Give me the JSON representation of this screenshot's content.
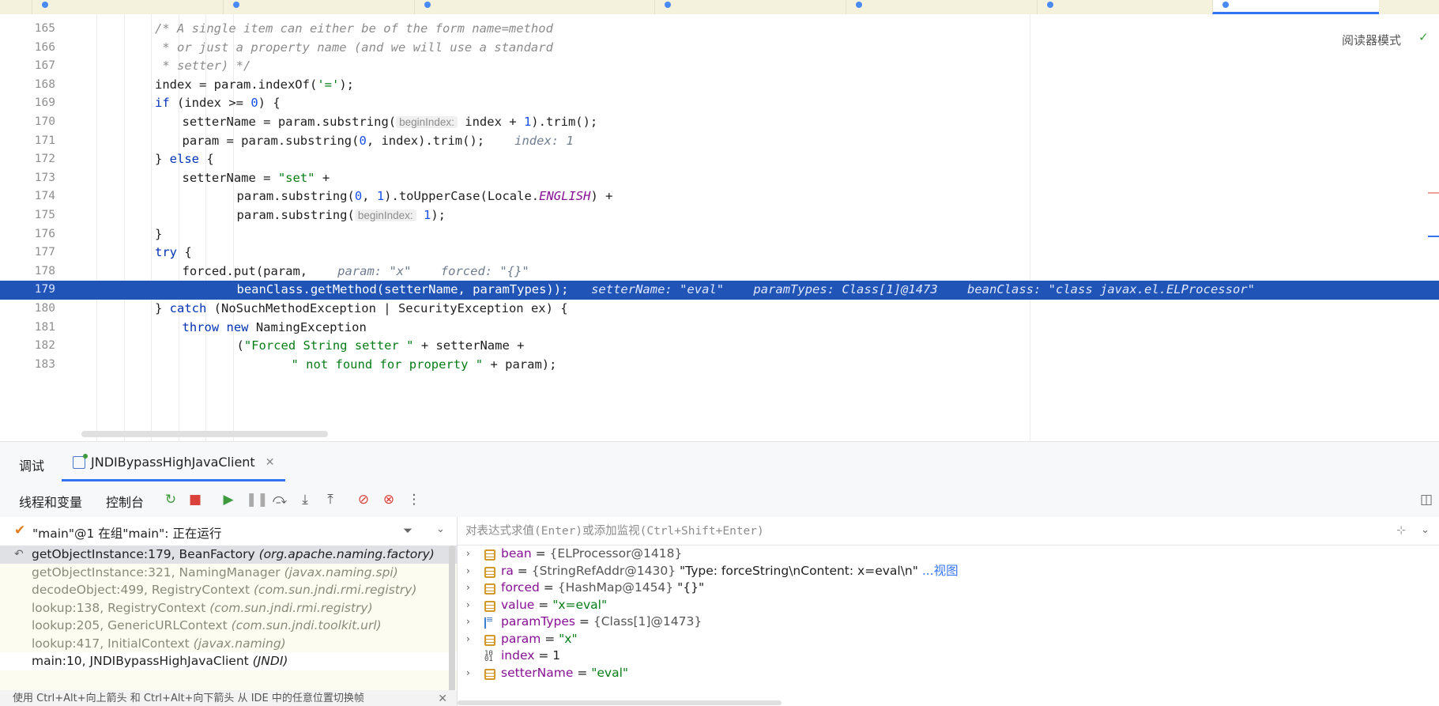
{
  "editor": {
    "reader_mode": "阅读器模式",
    "lines": [
      {
        "n": "165",
        "code": [
          {
            "t": "/* A single item can either be of the form name=method",
            "c": "cm"
          }
        ],
        "indent": 1
      },
      {
        "n": "166",
        "code": [
          {
            "t": " * or just a property name (and we will use a standard",
            "c": "cm"
          }
        ],
        "indent": 1
      },
      {
        "n": "167",
        "code": [
          {
            "t": " * setter) */",
            "c": "cm"
          }
        ],
        "indent": 1
      },
      {
        "n": "168",
        "code": [
          {
            "t": "index = param.indexOf(",
            "c": ""
          },
          {
            "t": "'='",
            "c": "str"
          },
          {
            "t": ");",
            "c": ""
          }
        ],
        "indent": 1
      },
      {
        "n": "169",
        "code": [
          {
            "t": "if",
            "c": "kw"
          },
          {
            "t": " (index >= ",
            "c": ""
          },
          {
            "t": "0",
            "c": "num"
          },
          {
            "t": ") {",
            "c": ""
          }
        ],
        "indent": 1
      },
      {
        "n": "170",
        "code": [
          {
            "t": "setterName = param.substring(",
            "c": ""
          },
          {
            "t": "beginIndex:",
            "c": "hint"
          },
          {
            "t": " index + ",
            "c": ""
          },
          {
            "t": "1",
            "c": "num"
          },
          {
            "t": ").trim();",
            "c": ""
          }
        ],
        "indent": 2
      },
      {
        "n": "171",
        "code": [
          {
            "t": "param = param.substring(",
            "c": ""
          },
          {
            "t": "0",
            "c": "num"
          },
          {
            "t": ", index).trim();",
            "c": ""
          },
          {
            "t": "   index: 1",
            "c": "inl"
          }
        ],
        "indent": 2
      },
      {
        "n": "172",
        "code": [
          {
            "t": "} ",
            "c": ""
          },
          {
            "t": "else",
            "c": "kw"
          },
          {
            "t": " {",
            "c": ""
          }
        ],
        "indent": 1
      },
      {
        "n": "173",
        "code": [
          {
            "t": "setterName = ",
            "c": ""
          },
          {
            "t": "\"set\"",
            "c": "str"
          },
          {
            "t": " +",
            "c": ""
          }
        ],
        "indent": 2
      },
      {
        "n": "174",
        "code": [
          {
            "t": "param.substring(",
            "c": ""
          },
          {
            "t": "0",
            "c": "num"
          },
          {
            "t": ", ",
            "c": ""
          },
          {
            "t": "1",
            "c": "num"
          },
          {
            "t": ").toUpperCase(Locale.",
            "c": ""
          },
          {
            "t": "ENGLISH",
            "c": "const"
          },
          {
            "t": ") +",
            "c": ""
          }
        ],
        "indent": 4
      },
      {
        "n": "175",
        "code": [
          {
            "t": "param.substring(",
            "c": ""
          },
          {
            "t": "beginIndex:",
            "c": "hint"
          },
          {
            "t": " ",
            "c": ""
          },
          {
            "t": "1",
            "c": "num"
          },
          {
            "t": ");",
            "c": ""
          }
        ],
        "indent": 4
      },
      {
        "n": "176",
        "code": [
          {
            "t": "}",
            "c": ""
          }
        ],
        "indent": 1
      },
      {
        "n": "177",
        "code": [
          {
            "t": "try",
            "c": "kw"
          },
          {
            "t": " {",
            "c": ""
          }
        ],
        "indent": 1
      },
      {
        "n": "178",
        "code": [
          {
            "t": "forced.put(param,",
            "c": ""
          },
          {
            "t": "   param: \"x\"    forced: \"{}\"",
            "c": "inl"
          }
        ],
        "indent": 2
      },
      {
        "n": "179",
        "code": [
          {
            "t": "beanClass.getMethod(setterName, paramTypes));",
            "c": ""
          },
          {
            "t": "  setterName: \"eval\"    paramTypes: Class[1]@1473    beanClass: \"class javax.el.ELProcessor\"",
            "c": "inl"
          }
        ],
        "indent": 4,
        "exec": true
      },
      {
        "n": "180",
        "code": [
          {
            "t": "} ",
            "c": ""
          },
          {
            "t": "catch",
            "c": "kw"
          },
          {
            "t": " (NoSuchMethodException | SecurityException ex) {",
            "c": ""
          }
        ],
        "indent": 1
      },
      {
        "n": "181",
        "code": [
          {
            "t": "throw new",
            "c": "kw"
          },
          {
            "t": " NamingException",
            "c": ""
          }
        ],
        "indent": 2
      },
      {
        "n": "182",
        "code": [
          {
            "t": "(",
            "c": ""
          },
          {
            "t": "\"Forced String setter \"",
            "c": "str"
          },
          {
            "t": " + setterName +",
            "c": ""
          }
        ],
        "indent": 4
      },
      {
        "n": "183",
        "code": [
          {
            "t": "\" not found for property \"",
            "c": "str"
          },
          {
            "t": " + param);",
            "c": ""
          }
        ],
        "indent": 6
      }
    ]
  },
  "debug": {
    "title": "调试",
    "session_label": "JNDIBypassHighJavaClient",
    "tab_threads": "线程和变量",
    "tab_console": "控制台",
    "thread_label": "\"main\"@1 在组\"main\": 正在运行",
    "frames": [
      {
        "method": "getObjectInstance:179, BeanFactory",
        "pkg": "(org.apache.naming.factory)",
        "kind": "selected"
      },
      {
        "method": "getObjectInstance:321, NamingManager",
        "pkg": "(javax.naming.spi)",
        "kind": "lib"
      },
      {
        "method": "decodeObject:499, RegistryContext",
        "pkg": "(com.sun.jndi.rmi.registry)",
        "kind": "lib"
      },
      {
        "method": "lookup:138, RegistryContext",
        "pkg": "(com.sun.jndi.rmi.registry)",
        "kind": "lib"
      },
      {
        "method": "lookup:205, GenericURLContext",
        "pkg": "(com.sun.jndi.toolkit.url)",
        "kind": "lib"
      },
      {
        "method": "lookup:417, InitialContext",
        "pkg": "(javax.naming)",
        "kind": "lib"
      },
      {
        "method": "main:10, JNDIBypassHighJavaClient",
        "pkg": "(JNDI)",
        "kind": "user"
      }
    ],
    "hint_text": "使用 Ctrl+Alt+向上箭头 和 Ctrl+Alt+向下箭头 从 IDE 中的任意位置切换帧",
    "eval_placeholder": "对表达式求值(Enter)或添加监视(Ctrl+Shift+Enter)",
    "variables": [
      {
        "name": "bean",
        "type": "{ELProcessor@1418}",
        "value": "",
        "icon": "field",
        "expand": true
      },
      {
        "name": "ra",
        "type": "{StringRefAddr@1430}",
        "value": "\"Type: forceString\\nContent: x=eval\\n\"",
        "link": "...视图",
        "icon": "field",
        "expand": true
      },
      {
        "name": "forced",
        "type": "{HashMap@1454}",
        "value": "\"{}\"",
        "icon": "field",
        "expand": true
      },
      {
        "name": "value",
        "type": "",
        "value": "\"x=eval\"",
        "icon": "field",
        "expand": true
      },
      {
        "name": "paramTypes",
        "type": "{Class[1]@1473}",
        "value": "",
        "icon": "arr",
        "expand": true
      },
      {
        "name": "param",
        "type": "",
        "value": "\"x\"",
        "icon": "field",
        "expand": true
      },
      {
        "name": "index",
        "type": "",
        "value": "1",
        "icon": "prim",
        "expand": false
      },
      {
        "name": "setterName",
        "type": "",
        "value": "\"eval\"",
        "icon": "field",
        "expand": true
      }
    ]
  }
}
